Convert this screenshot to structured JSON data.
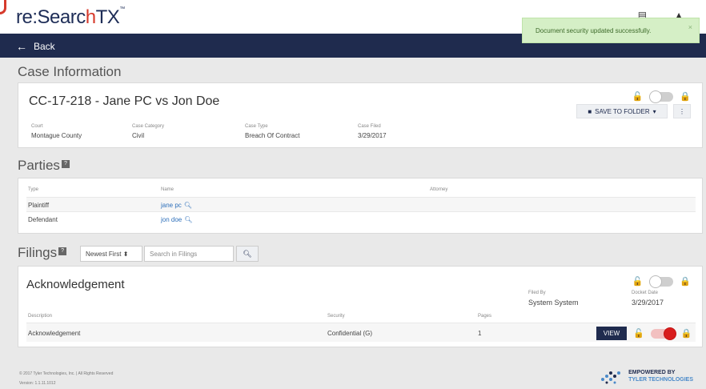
{
  "header": {
    "logo_prefix": "re:",
    "logo_main": "Searc",
    "logo_accent": "h",
    "logo_suffix": "TX",
    "logo_tm": "™",
    "icon_menu": "▤",
    "icon_user": "▲"
  },
  "nav": {
    "back_label": "Back"
  },
  "toast": {
    "message": "Document security updated successfully.",
    "close": "×"
  },
  "case_info": {
    "section_title": "Case Information",
    "title": "CC-17-218 - Jane PC vs Jon Doe",
    "save_to_folder": "SAVE TO FOLDER",
    "fields": [
      {
        "label": "Court",
        "value": "Montague County"
      },
      {
        "label": "Case Category",
        "value": "Civil"
      },
      {
        "label": "Case Type",
        "value": "Breach Of Contract"
      },
      {
        "label": "Case Filed",
        "value": "3/29/2017"
      }
    ]
  },
  "parties": {
    "section_title": "Parties",
    "columns": [
      "Type",
      "Name",
      "Attorney"
    ],
    "rows": [
      {
        "type": "Plaintiff",
        "name": "jane pc",
        "attorney": ""
      },
      {
        "type": "Defendant",
        "name": "jon doe",
        "attorney": ""
      }
    ]
  },
  "filings": {
    "section_title": "Filings",
    "sort_selected": "Newest First",
    "search_placeholder": "Search in Filings",
    "items": [
      {
        "title": "Acknowledgement",
        "filed_by_label": "Filed By",
        "filed_by": "System System",
        "docket_date_label": "Docket Date",
        "docket_date": "3/29/2017",
        "columns": [
          "Description",
          "Security",
          "Pages"
        ],
        "row": {
          "description": "Acknowledgement",
          "security": "Confidential (G)",
          "pages": "1"
        },
        "view_label": "VIEW",
        "security_toggle_on": true
      }
    ]
  },
  "footer": {
    "copyright": "© 2017 Tyler Technologies, Inc. | All Rights Reserved",
    "version": "Version: 1.1.11.1012",
    "brand_line1": "EMPOWERED BY",
    "brand_line2": "TYLER TECHNOLOGIES"
  },
  "colors": {
    "navy": "#1f2b4e",
    "brand_red": "#d63a2c",
    "toast_bg": "#d5efc6",
    "link_blue": "#2d6fba",
    "toggle_on": "#d81d1d"
  }
}
